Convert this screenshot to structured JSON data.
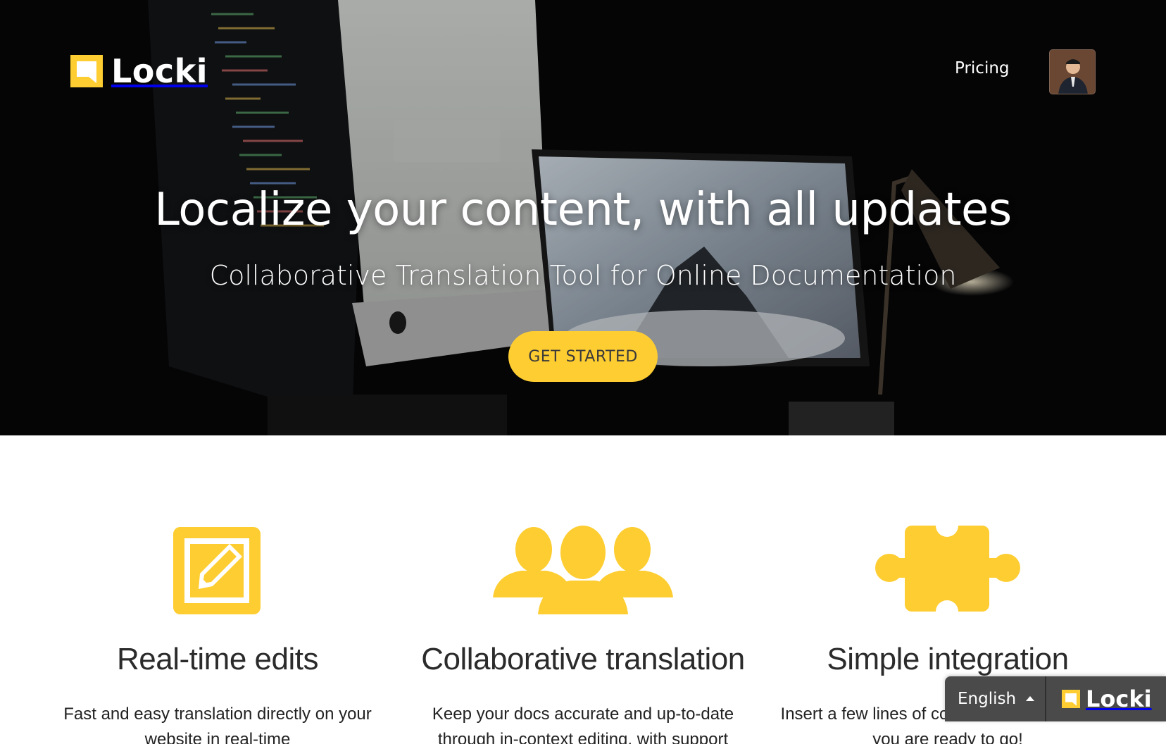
{
  "header": {
    "logo_text": "Locki",
    "nav": {
      "pricing_label": "Pricing"
    }
  },
  "hero": {
    "title": "Localize your content, with all updates",
    "subtitle": "Collaborative Translation Tool for Online Documentation",
    "cta_label": "GET STARTED"
  },
  "features": [
    {
      "icon": "edit-icon",
      "title": "Real-time edits",
      "description": "Fast and easy translation directly on your website in real-time"
    },
    {
      "icon": "users-icon",
      "title": "Collaborative translation",
      "description": "Keep your docs accurate and up-to-date through in-context editing, with support"
    },
    {
      "icon": "puzzle-icon",
      "title": "Simple integration",
      "description": "Insert a few lines of code to the html file, and you are ready to go!"
    }
  ],
  "language_widget": {
    "current_language": "English",
    "brand_text": "Locki"
  },
  "colors": {
    "accent": "#fecd31",
    "hero_background": "#0b0b0c",
    "widget_background": "#4a4a4a"
  }
}
